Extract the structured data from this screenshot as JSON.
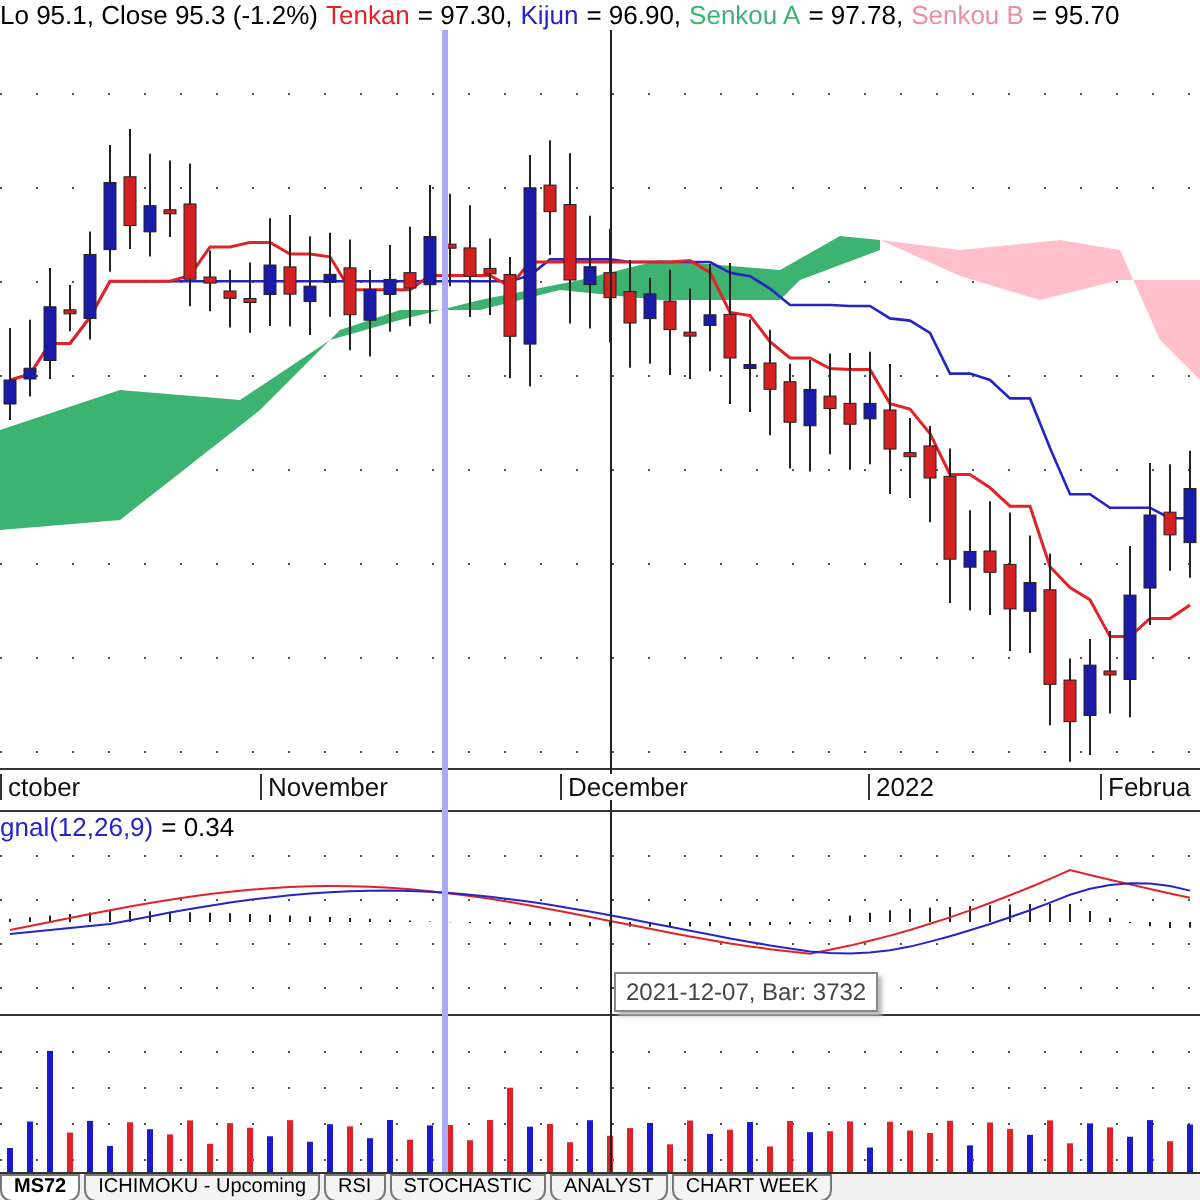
{
  "price_legend": {
    "prefix": "Lo 95.1, Close 95.3 (-1.2%)",
    "lines": [
      {
        "name": "Tenkan",
        "value": "= 97.30,",
        "color": "#e32228"
      },
      {
        "name": "Kijun",
        "value": "= 96.90,",
        "color": "#2424c8"
      },
      {
        "name": "Senkou A",
        "value": "= 97.78,",
        "color": "#3cb371"
      },
      {
        "name": "Senkou B",
        "value": "= 95.70",
        "color": "#ea8ea2"
      }
    ]
  },
  "x_axis": {
    "labels": [
      "ctober",
      "November",
      "December",
      "2022",
      "Februa"
    ]
  },
  "macd_legend": {
    "name": "gnal(12,26,9)",
    "value": "= 0.34"
  },
  "tooltip": "2021-12-07, Bar: 3732",
  "tabs": [
    {
      "label": "MS72",
      "selected": true
    },
    {
      "label": "ICHIMOKU - Upcoming",
      "selected": false
    },
    {
      "label": "RSI",
      "selected": false
    },
    {
      "label": "STOCHASTIC",
      "selected": false
    },
    {
      "label": "ANALYST",
      "selected": false
    },
    {
      "label": "CHART WEEK",
      "selected": false
    }
  ]
}
